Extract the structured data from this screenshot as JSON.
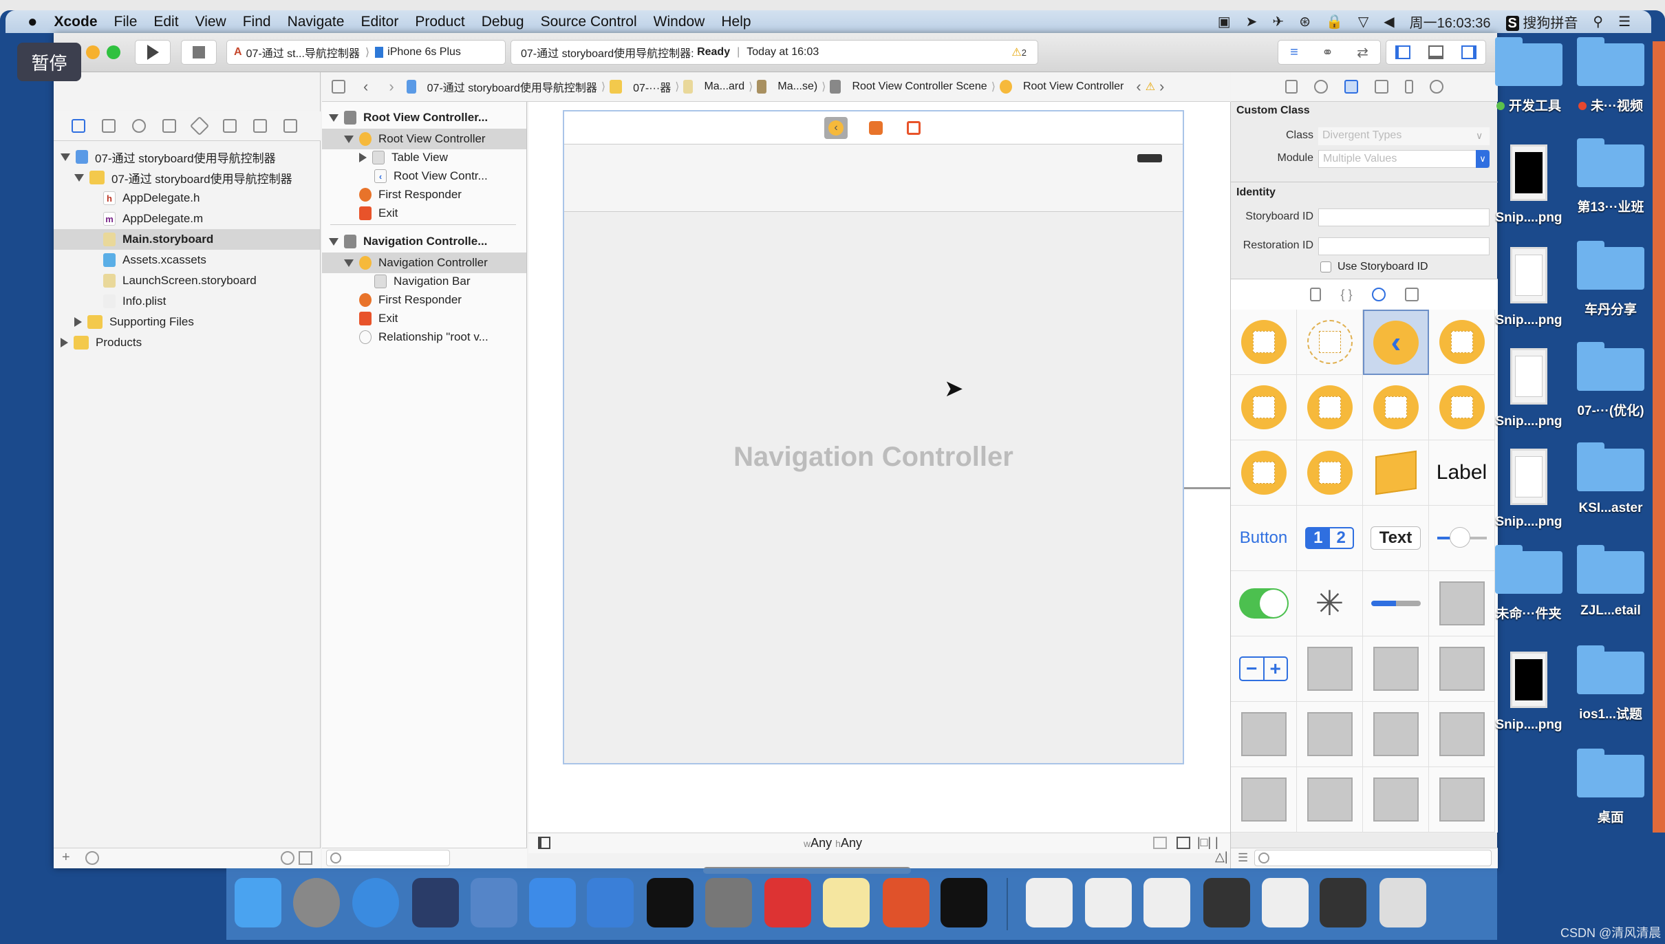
{
  "menubar": {
    "apple": "",
    "items": [
      "Xcode",
      "File",
      "Edit",
      "View",
      "Find",
      "Navigate",
      "Editor",
      "Product",
      "Debug",
      "Source Control",
      "Window",
      "Help"
    ],
    "clock": "周一16:03:36",
    "input_method": "搜狗拼音"
  },
  "overlay": {
    "pause": "暂停"
  },
  "toolbar": {
    "scheme": "07-通过 st...导航控制器",
    "device": "iPhone 6s Plus",
    "status_project": "07-通过 storyboard使用导航控制器:",
    "status_state": "Ready",
    "status_time": "Today at 16:03",
    "warnings": "2"
  },
  "jumpbar": [
    "07-通过 storyboard使用导航控制器",
    "07-···器",
    "Ma...ard",
    "Ma...se)",
    "Root View Controller Scene",
    "Root View Controller"
  ],
  "navigator": {
    "items": [
      {
        "label": "07-通过 storyboard使用导航控制器",
        "icon": "project-icon",
        "level": 0,
        "open": true
      },
      {
        "label": "07-通过 storyboard使用导航控制器",
        "icon": "folder-icon",
        "level": 1,
        "open": true
      },
      {
        "label": "AppDelegate.h",
        "icon": "h",
        "level": 2
      },
      {
        "label": "AppDelegate.m",
        "icon": "m",
        "level": 2
      },
      {
        "label": "Main.storyboard",
        "icon": "storyboard-icon",
        "level": 2,
        "selected": true
      },
      {
        "label": "Assets.xcassets",
        "icon": "assets-icon",
        "level": 2
      },
      {
        "label": "LaunchScreen.storyboard",
        "icon": "storyboard-icon",
        "level": 2
      },
      {
        "label": "Info.plist",
        "icon": "plist-icon",
        "level": 2
      },
      {
        "label": "Supporting Files",
        "icon": "folder-icon",
        "level": 1,
        "open": false
      },
      {
        "label": "Products",
        "icon": "folder-icon",
        "level": 0,
        "open": false
      }
    ]
  },
  "outline": {
    "items": [
      {
        "label": "Root View Controller...",
        "level": 0,
        "bold": true,
        "tri": "down"
      },
      {
        "label": "Root View Controller",
        "level": 1,
        "selected": true,
        "tri": "down",
        "icon": "yellow"
      },
      {
        "label": "Table View",
        "level": 2,
        "tri": "right",
        "icon": "gray"
      },
      {
        "label": "Root View Contr...",
        "level": 2,
        "icon": "back"
      },
      {
        "label": "First Responder",
        "level": 1,
        "icon": "orange"
      },
      {
        "label": "Exit",
        "level": 1,
        "icon": "exit"
      },
      {
        "label": "Navigation Controlle...",
        "level": 0,
        "bold": true,
        "tri": "down",
        "sep": true
      },
      {
        "label": "Navigation Controller",
        "level": 1,
        "selected": true,
        "tri": "down",
        "icon": "yellow"
      },
      {
        "label": "Navigation Bar",
        "level": 2,
        "icon": "gray"
      },
      {
        "label": "First Responder",
        "level": 1,
        "icon": "orange"
      },
      {
        "label": "Exit",
        "level": 1,
        "icon": "exit"
      },
      {
        "label": "Relationship \"root v...",
        "level": 1,
        "icon": "circle"
      }
    ]
  },
  "canvas": {
    "scene_title": "Navigation Controller",
    "size_class_w": "w",
    "size_class_any1": "Any",
    "size_class_h": "h",
    "size_class_any2": "Any"
  },
  "inspector": {
    "custom_class": "Custom Class",
    "class_label": "Class",
    "class_placeholder": "Divergent Types",
    "module_label": "Module",
    "module_placeholder": "Multiple Values",
    "identity": "Identity",
    "storyboard_id_label": "Storyboard ID",
    "storyboard_id": "",
    "restoration_id_label": "Restoration ID",
    "restoration_id": "",
    "use_storyboard_id": "Use Storyboard ID",
    "use_storyboard_checked": false
  },
  "library": [
    {
      "kind": "view-controller"
    },
    {
      "kind": "storyboard-reference"
    },
    {
      "kind": "navigation-controller",
      "selected": true
    },
    {
      "kind": "table-view-controller"
    },
    {
      "kind": "collection-view-controller"
    },
    {
      "kind": "tab-bar-controller"
    },
    {
      "kind": "split-view-controller"
    },
    {
      "kind": "page-view-controller"
    },
    {
      "kind": "glkit-view-controller"
    },
    {
      "kind": "av-player-view-controller"
    },
    {
      "kind": "object"
    },
    {
      "kind": "label",
      "text": "Label"
    },
    {
      "kind": "button",
      "text": "Button"
    },
    {
      "kind": "segmented-control",
      "text": "1",
      "text2": "2"
    },
    {
      "kind": "text-field",
      "text": "Text"
    },
    {
      "kind": "slider"
    },
    {
      "kind": "switch"
    },
    {
      "kind": "activity-indicator"
    },
    {
      "kind": "progress-view"
    },
    {
      "kind": "page-control"
    },
    {
      "kind": "stepper"
    },
    {
      "kind": "horizontal-stack-view"
    },
    {
      "kind": "vertical-stack-view"
    },
    {
      "kind": "table-view"
    },
    {
      "kind": "table-view-cell"
    },
    {
      "kind": "image-view"
    },
    {
      "kind": "collection-view"
    },
    {
      "kind": "collection-view-cell"
    },
    {
      "kind": "collection-reusable-view"
    },
    {
      "kind": "text-view"
    },
    {
      "kind": "scroll-view"
    },
    {
      "kind": "date-picker"
    }
  ],
  "desktop": {
    "left": [
      {
        "label": "开发工具",
        "type": "folder",
        "tag": "#5cc04b"
      },
      {
        "label": "Snip....png",
        "type": "thumb"
      },
      {
        "label": "Snip....png",
        "type": "thumb"
      },
      {
        "label": "Snip....png",
        "type": "thumb"
      },
      {
        "label": "Snip....png",
        "type": "thumb"
      },
      {
        "label": "未命···件夹",
        "type": "folder"
      },
      {
        "label": "Snip....png",
        "type": "thumb"
      }
    ],
    "right": [
      {
        "label": "未···视频",
        "type": "folder",
        "tag": "#e5472f"
      },
      {
        "label": "第13···业班",
        "type": "folder"
      },
      {
        "label": "车丹分享",
        "type": "folder"
      },
      {
        "label": "07-···(优化)",
        "type": "folder"
      },
      {
        "label": "KSI...aster",
        "type": "folder"
      },
      {
        "label": "ZJL...etail",
        "type": "folder"
      },
      {
        "label": "ios1...试题",
        "type": "folder"
      },
      {
        "label": "桌面",
        "type": "folder"
      }
    ]
  },
  "dock": [
    "finder",
    "launchpad",
    "safari",
    "mouse",
    "photo-slideshow",
    "xcode",
    "instruments",
    "terminal",
    "system-preferences",
    "xmind",
    "notes",
    "powerpoint",
    "console",
    "doc-1",
    "doc-2",
    "doc-3",
    "doc-4",
    "doc-5",
    "doc-6",
    "trash"
  ],
  "watermark": "CSDN @清风清晨",
  "colors": {
    "accent": "#2f6fe0",
    "controller_yellow": "#f6b93b",
    "desktop": "#1b4a8c"
  }
}
